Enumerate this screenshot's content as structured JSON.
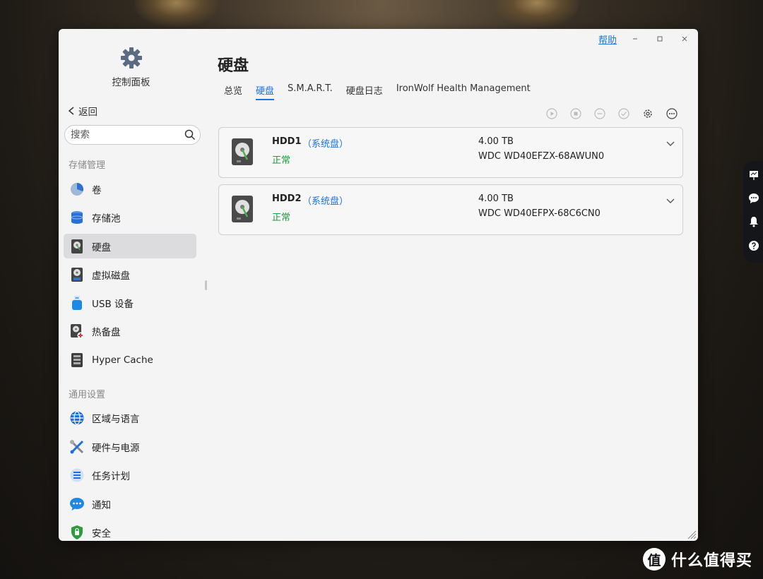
{
  "window": {
    "help_label": "帮助",
    "minimize_icon": "minimize-icon",
    "maximize_icon": "maximize-icon",
    "close_icon": "close-icon"
  },
  "app": {
    "title": "控制面板",
    "icon": "gear-icon"
  },
  "sidebar": {
    "back_label": "返回",
    "search_placeholder": "搜索",
    "storage_section": "存储管理",
    "storage_items": [
      {
        "label": "卷",
        "icon": "volume-pie-icon"
      },
      {
        "label": "存储池",
        "icon": "storage-pool-icon"
      },
      {
        "label": "硬盘",
        "icon": "hard-disk-icon",
        "active": true
      },
      {
        "label": "虚拟磁盘",
        "icon": "virtual-disk-icon"
      },
      {
        "label": "USB 设备",
        "icon": "usb-icon"
      },
      {
        "label": "热备盘",
        "icon": "hot-spare-icon"
      },
      {
        "label": "Hyper Cache",
        "icon": "hyper-cache-icon"
      }
    ],
    "general_section": "通用设置",
    "general_items": [
      {
        "label": "区域与语言",
        "icon": "globe-icon"
      },
      {
        "label": "硬件与电源",
        "icon": "tools-icon"
      },
      {
        "label": "任务计划",
        "icon": "task-schedule-icon"
      },
      {
        "label": "通知",
        "icon": "chat-bubble-icon"
      },
      {
        "label": "安全",
        "icon": "shield-icon"
      }
    ]
  },
  "main": {
    "title": "硬盘",
    "tabs": [
      {
        "label": "总览"
      },
      {
        "label": "硬盘",
        "active": true
      },
      {
        "label": "S.M.A.R.T."
      },
      {
        "label": "硬盘日志"
      },
      {
        "label": "IronWolf Health Management"
      }
    ],
    "toolbar_icons": [
      "play-icon",
      "stop-icon",
      "minus-circle-icon",
      "check-circle-icon",
      "settings-icon",
      "more-icon"
    ],
    "disks": [
      {
        "name": "HDD1",
        "tag": "（系统盘）",
        "status": "正常",
        "size": "4.00 TB",
        "model": "WDC WD40EFZX-68AWUN0"
      },
      {
        "name": "HDD2",
        "tag": "（系统盘）",
        "status": "正常",
        "size": "4.00 TB",
        "model": "WDC WD40EFPX-68C6CN0"
      }
    ]
  },
  "floating_bar": [
    "presentation-icon",
    "comment-icon",
    "bell-icon",
    "question-icon"
  ],
  "watermark": {
    "logo": "值",
    "text": "什么值得买"
  },
  "colors": {
    "accent": "#1a73e8",
    "ok": "#1e9b3a"
  }
}
